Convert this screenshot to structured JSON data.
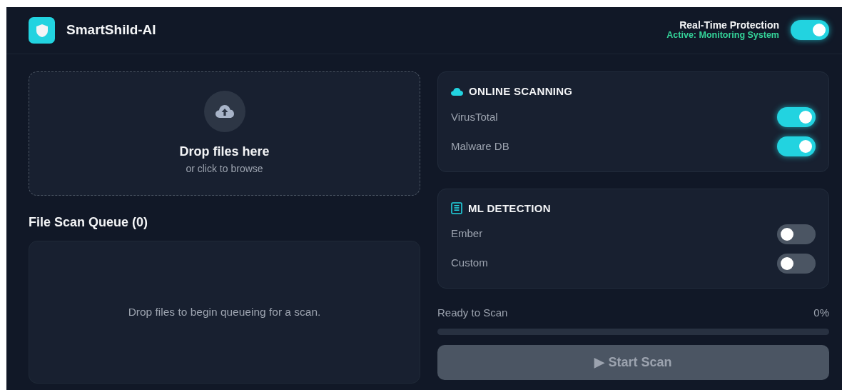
{
  "app": {
    "title": "SmartShild-AI"
  },
  "protection": {
    "label": "Real-Time Protection",
    "status": "Active: Monitoring System",
    "on": true
  },
  "dropzone": {
    "title": "Drop files here",
    "subtitle": "or click to browse"
  },
  "queue": {
    "title": "File Scan Queue (0)",
    "empty_message": "Drop files to begin queueing for a scan."
  },
  "panels": [
    {
      "kind": "cloud",
      "title": "ONLINE SCANNING",
      "options": [
        {
          "label": "VirusTotal",
          "on": true
        },
        {
          "label": "Malware DB",
          "on": true
        }
      ]
    },
    {
      "kind": "list",
      "title": "ML DETECTION",
      "options": [
        {
          "label": "Ember",
          "on": false
        },
        {
          "label": "Custom",
          "on": false
        }
      ]
    }
  ],
  "progress": {
    "label": "Ready to Scan",
    "reading": "0%",
    "level": 0
  },
  "start_button": {
    "label": "▶ Start Scan",
    "disabled": true
  }
}
